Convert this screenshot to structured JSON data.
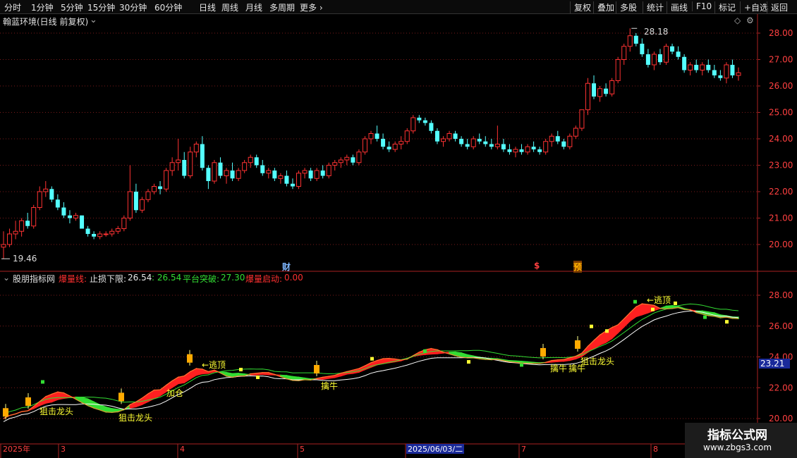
{
  "toolbar": {
    "periods": [
      "分时",
      "1分钟",
      "5分钟",
      "15分钟",
      "30分钟",
      "60分钟",
      "日线",
      "周线",
      "月线",
      "多周期",
      "更多"
    ],
    "active_period": "日线",
    "right_buttons": [
      "复权",
      "叠加",
      "多股",
      "统计",
      "画线",
      "F10",
      "标记",
      "+自选",
      "返回"
    ]
  },
  "main_panel": {
    "title": "翰蓝环境(日线 前复权)",
    "high_label": "28.18",
    "low_label": "19.46",
    "markers": {
      "cai": "财",
      "dollar": "$",
      "yu": "预"
    },
    "y_ticks": [
      "28.00",
      "27.00",
      "26.00",
      "25.00",
      "24.00",
      "23.00",
      "22.00",
      "21.00",
      "20.00"
    ]
  },
  "indicator_panel": {
    "name": "股朋指标网",
    "f1_name": "爆量线:",
    "f2_label": "止损下限:",
    "f2_value": "26.54",
    "f3_value": ": 26.54",
    "f4_label": "平台突破:",
    "f4_value": "27.30",
    "f5_label": "爆量启动:",
    "f5_value": "0.00",
    "y_ticks": [
      "28.00",
      "26.00",
      "24.00",
      "22.00",
      "20.00"
    ],
    "current_value": "23.21",
    "signals": {
      "escape_top": "←逃顶",
      "snipe_dragon": "狙击龙头",
      "add_position": "加仓",
      "catch_bull": "擒牛"
    }
  },
  "date_axis": {
    "labels": [
      "2025年",
      "3",
      "4",
      "5",
      "2025/06/03/二",
      "7",
      "8"
    ]
  },
  "watermark": {
    "title": "指标公式网",
    "url": "www.zbgs3.com"
  },
  "colors": {
    "up": "#ff3232",
    "down": "#54ffff",
    "grid": "#7a1a1a",
    "axis": "#aa2222",
    "red_band": "#ff2020",
    "green_band": "#33dd33",
    "yellow": "#ffff33"
  },
  "chart_data": {
    "type": "candlestick",
    "title": "翰蓝环境(日线 前复权)",
    "ylim": [
      19.6,
      28.5
    ],
    "candles": [
      [
        19.9,
        20.5,
        19.46,
        20.0
      ],
      [
        20.0,
        20.6,
        19.9,
        20.4
      ],
      [
        20.4,
        20.9,
        20.2,
        20.5
      ],
      [
        20.5,
        21.0,
        20.3,
        20.9
      ],
      [
        20.9,
        21.2,
        20.6,
        20.7
      ],
      [
        20.7,
        21.5,
        20.6,
        21.4
      ],
      [
        21.4,
        22.2,
        21.3,
        22.0
      ],
      [
        22.0,
        22.4,
        21.8,
        22.1
      ],
      [
        22.1,
        22.2,
        21.6,
        21.7
      ],
      [
        21.7,
        21.9,
        21.3,
        21.4
      ],
      [
        21.4,
        21.6,
        21.0,
        21.1
      ],
      [
        21.1,
        21.3,
        20.8,
        21.0
      ],
      [
        21.0,
        21.2,
        20.9,
        21.1
      ],
      [
        21.1,
        21.1,
        20.6,
        20.6
      ],
      [
        20.6,
        20.7,
        20.3,
        20.4
      ],
      [
        20.4,
        20.5,
        20.2,
        20.3
      ],
      [
        20.3,
        20.5,
        20.2,
        20.4
      ],
      [
        20.4,
        20.5,
        20.3,
        20.4
      ],
      [
        20.4,
        20.6,
        20.3,
        20.5
      ],
      [
        20.5,
        20.7,
        20.4,
        20.6
      ],
      [
        20.6,
        21.1,
        20.5,
        21.0
      ],
      [
        21.0,
        23.0,
        20.9,
        22.0
      ],
      [
        22.0,
        22.3,
        21.2,
        21.3
      ],
      [
        21.3,
        21.8,
        21.2,
        21.7
      ],
      [
        21.7,
        22.1,
        21.6,
        22.0
      ],
      [
        22.0,
        22.3,
        21.9,
        22.2
      ],
      [
        22.2,
        22.4,
        21.9,
        22.1
      ],
      [
        22.1,
        22.9,
        22.0,
        22.8
      ],
      [
        22.8,
        23.3,
        22.6,
        23.1
      ],
      [
        23.1,
        24.0,
        22.8,
        23.2
      ],
      [
        23.2,
        23.5,
        22.5,
        22.6
      ],
      [
        22.6,
        23.7,
        22.5,
        23.5
      ],
      [
        23.5,
        23.9,
        23.3,
        23.8
      ],
      [
        23.8,
        24.1,
        22.8,
        22.9
      ],
      [
        22.9,
        23.0,
        22.1,
        22.4
      ],
      [
        22.4,
        23.2,
        22.3,
        23.1
      ],
      [
        23.1,
        23.3,
        22.5,
        22.6
      ],
      [
        22.6,
        22.9,
        22.3,
        22.8
      ],
      [
        22.8,
        23.1,
        22.4,
        22.5
      ],
      [
        22.5,
        22.9,
        22.4,
        22.8
      ],
      [
        22.8,
        23.2,
        22.7,
        23.1
      ],
      [
        23.1,
        23.4,
        22.9,
        23.3
      ],
      [
        23.3,
        23.4,
        22.9,
        23.0
      ],
      [
        23.0,
        23.2,
        22.6,
        22.7
      ],
      [
        22.7,
        22.9,
        22.5,
        22.8
      ],
      [
        22.8,
        22.9,
        22.4,
        22.5
      ],
      [
        22.5,
        22.7,
        22.3,
        22.6
      ],
      [
        22.6,
        22.8,
        22.2,
        22.3
      ],
      [
        22.3,
        22.5,
        22.1,
        22.2
      ],
      [
        22.2,
        22.8,
        22.1,
        22.7
      ],
      [
        22.7,
        22.9,
        22.5,
        22.8
      ],
      [
        22.8,
        22.9,
        22.4,
        22.5
      ],
      [
        22.5,
        22.9,
        22.4,
        22.8
      ],
      [
        22.8,
        23.0,
        22.5,
        22.6
      ],
      [
        22.6,
        23.1,
        22.5,
        23.0
      ],
      [
        23.0,
        23.2,
        22.8,
        23.1
      ],
      [
        23.1,
        23.3,
        22.9,
        23.2
      ],
      [
        23.2,
        23.4,
        23.0,
        23.3
      ],
      [
        23.3,
        23.4,
        23.0,
        23.1
      ],
      [
        23.1,
        23.6,
        23.0,
        23.5
      ],
      [
        23.5,
        24.1,
        23.4,
        24.0
      ],
      [
        24.0,
        24.3,
        23.8,
        24.2
      ],
      [
        24.2,
        24.5,
        23.9,
        24.0
      ],
      [
        24.0,
        24.2,
        23.6,
        23.7
      ],
      [
        23.7,
        23.9,
        23.5,
        23.6
      ],
      [
        23.6,
        23.9,
        23.5,
        23.8
      ],
      [
        23.8,
        24.1,
        23.6,
        23.9
      ],
      [
        23.9,
        24.4,
        23.8,
        24.3
      ],
      [
        24.3,
        24.9,
        24.2,
        24.8
      ],
      [
        24.8,
        24.9,
        24.6,
        24.7
      ],
      [
        24.7,
        24.8,
        24.5,
        24.6
      ],
      [
        24.6,
        24.7,
        24.2,
        24.3
      ],
      [
        24.3,
        24.4,
        23.8,
        23.9
      ],
      [
        23.9,
        24.1,
        23.7,
        24.0
      ],
      [
        24.0,
        24.3,
        23.9,
        24.2
      ],
      [
        24.2,
        24.3,
        23.9,
        24.0
      ],
      [
        24.0,
        24.1,
        23.7,
        23.8
      ],
      [
        23.8,
        24.0,
        23.6,
        23.7
      ],
      [
        23.7,
        24.1,
        23.6,
        24.0
      ],
      [
        24.0,
        24.2,
        23.8,
        23.9
      ],
      [
        23.9,
        24.1,
        23.7,
        23.8
      ],
      [
        23.8,
        24.0,
        23.6,
        23.7
      ],
      [
        23.7,
        24.5,
        23.6,
        23.8
      ],
      [
        23.8,
        24.0,
        23.5,
        23.6
      ],
      [
        23.6,
        23.8,
        23.4,
        23.5
      ],
      [
        23.5,
        23.7,
        23.3,
        23.6
      ],
      [
        23.6,
        23.8,
        23.4,
        23.5
      ],
      [
        23.5,
        23.8,
        23.4,
        23.7
      ],
      [
        23.7,
        23.9,
        23.5,
        23.6
      ],
      [
        23.6,
        23.7,
        23.4,
        23.5
      ],
      [
        23.5,
        24.0,
        23.4,
        23.9
      ],
      [
        23.9,
        24.2,
        23.7,
        24.1
      ],
      [
        24.1,
        24.3,
        23.8,
        23.9
      ],
      [
        23.9,
        24.0,
        23.6,
        23.7
      ],
      [
        23.7,
        24.2,
        23.6,
        24.1
      ],
      [
        24.1,
        24.5,
        24.0,
        24.4
      ],
      [
        24.4,
        25.0,
        24.3,
        25.1
      ],
      [
        25.1,
        26.3,
        24.9,
        26.1
      ],
      [
        26.1,
        26.4,
        25.5,
        25.6
      ],
      [
        25.6,
        26.0,
        25.4,
        25.9
      ],
      [
        25.9,
        26.1,
        25.6,
        25.7
      ],
      [
        25.7,
        26.3,
        25.6,
        26.2
      ],
      [
        26.2,
        27.1,
        26.1,
        27.0
      ],
      [
        27.0,
        27.6,
        26.8,
        27.5
      ],
      [
        27.5,
        28.18,
        27.3,
        27.9
      ],
      [
        27.9,
        28.0,
        27.5,
        27.6
      ],
      [
        27.6,
        27.8,
        27.1,
        27.2
      ],
      [
        27.2,
        27.4,
        26.7,
        26.8
      ],
      [
        26.8,
        27.3,
        26.6,
        27.2
      ],
      [
        27.2,
        27.4,
        26.8,
        26.9
      ],
      [
        26.9,
        27.6,
        26.8,
        27.5
      ],
      [
        27.5,
        27.6,
        27.2,
        27.3
      ],
      [
        27.3,
        27.5,
        27.0,
        27.1
      ],
      [
        27.1,
        27.2,
        26.5,
        26.6
      ],
      [
        26.6,
        26.9,
        26.4,
        26.8
      ],
      [
        26.8,
        27.0,
        26.5,
        26.6
      ],
      [
        26.6,
        26.9,
        26.4,
        26.8
      ],
      [
        26.8,
        27.0,
        26.5,
        26.6
      ],
      [
        26.6,
        26.8,
        26.3,
        26.4
      ],
      [
        26.4,
        26.6,
        26.2,
        26.3
      ],
      [
        26.3,
        26.9,
        26.1,
        26.8
      ],
      [
        26.8,
        27.0,
        26.3,
        26.4
      ],
      [
        26.4,
        26.7,
        26.2,
        26.5
      ]
    ]
  }
}
